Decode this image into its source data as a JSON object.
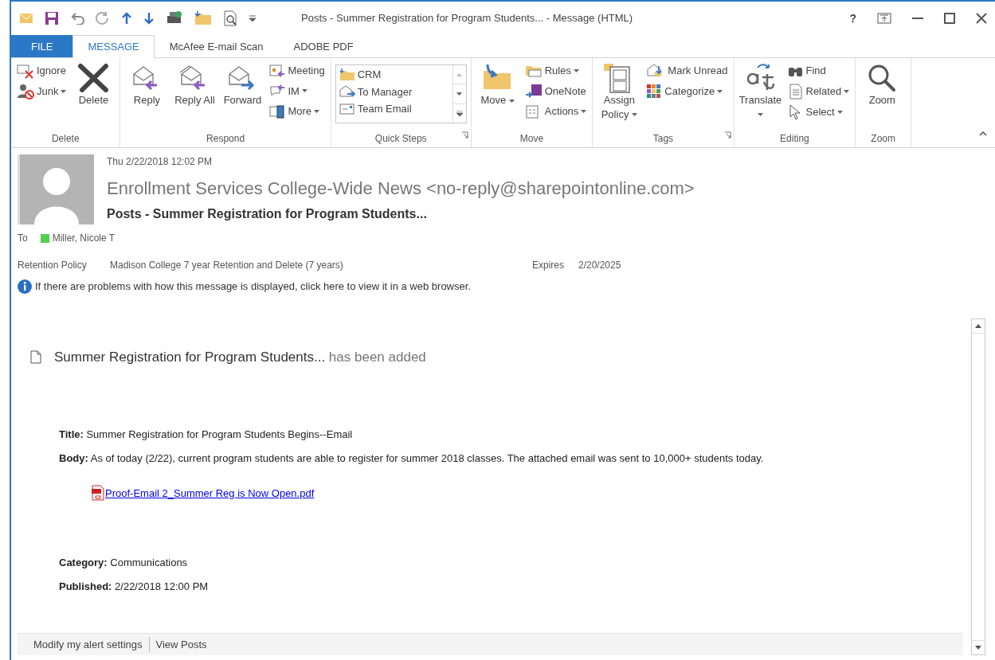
{
  "window": {
    "title": "Posts - Summer Registration for Program Students... - Message (HTML)",
    "help": "?"
  },
  "tabs": [
    {
      "label": "FILE",
      "kind": "file",
      "selected": false
    },
    {
      "label": "MESSAGE",
      "kind": "tab",
      "selected": true
    },
    {
      "label": "McAfee E-mail Scan",
      "kind": "tab",
      "selected": false
    },
    {
      "label": "ADOBE PDF",
      "kind": "tab",
      "selected": false
    }
  ],
  "ribbon": [
    {
      "name": "Delete",
      "launcher": false,
      "items": [
        {
          "kind": "small",
          "label": "Ignore",
          "dropdown": false
        },
        {
          "kind": "small",
          "label": "Junk",
          "dropdown": true
        },
        {
          "kind": "large",
          "label": "Delete",
          "dropdown": false
        }
      ]
    },
    {
      "name": "Respond",
      "launcher": false,
      "items": [
        {
          "kind": "large",
          "label": "Reply",
          "dropdown": false
        },
        {
          "kind": "large",
          "label": "Reply All",
          "dropdown": false
        },
        {
          "kind": "large",
          "label": "Forward",
          "dropdown": false
        },
        {
          "kind": "small",
          "label": "Meeting",
          "dropdown": false
        },
        {
          "kind": "small",
          "label": "IM",
          "dropdown": true
        },
        {
          "kind": "small",
          "label": "More",
          "dropdown": true
        }
      ]
    },
    {
      "name": "Quick Steps",
      "launcher": true,
      "items": [
        {
          "kind": "gallery",
          "entries": [
            "CRM",
            "To Manager",
            "Team Email"
          ]
        }
      ]
    },
    {
      "name": "Move",
      "launcher": false,
      "items": [
        {
          "kind": "large",
          "label": "Move",
          "dropdown": true
        },
        {
          "kind": "small",
          "label": "Rules",
          "dropdown": true
        },
        {
          "kind": "small",
          "label": "OneNote",
          "dropdown": false
        },
        {
          "kind": "small",
          "label": "Actions",
          "dropdown": true
        }
      ]
    },
    {
      "name": "Tags",
      "launcher": true,
      "items": [
        {
          "kind": "large",
          "label": "Assign Policy",
          "dropdown": true
        },
        {
          "kind": "small",
          "label": "Mark Unread",
          "dropdown": false
        },
        {
          "kind": "small",
          "label": "Categorize",
          "dropdown": true
        }
      ]
    },
    {
      "name": "Editing",
      "launcher": false,
      "items": [
        {
          "kind": "large",
          "label": "Translate",
          "dropdown": true
        },
        {
          "kind": "small",
          "label": "Find",
          "dropdown": false
        },
        {
          "kind": "small",
          "label": "Related",
          "dropdown": true
        },
        {
          "kind": "small",
          "label": "Select",
          "dropdown": true
        }
      ]
    },
    {
      "name": "Zoom",
      "launcher": false,
      "items": [
        {
          "kind": "large",
          "label": "Zoom",
          "dropdown": false
        }
      ]
    }
  ],
  "header": {
    "date": "Thu 2/22/2018 12:02 PM",
    "sender": "Enrollment Services College-Wide News <no-reply@sharepointonline.com>",
    "subject": "Posts - Summer Registration for Program Students...",
    "to_label": "To",
    "recipients": [
      {
        "name": "Miller, Nicole T",
        "color": "#4fd04f"
      }
    ],
    "retention_label": "Retention Policy",
    "retention_value": "Madison College 7 year Retention and Delete (7 years)",
    "expires_label": "Expires",
    "expires_value": "2/20/2025",
    "info": "If there are problems with how this message is displayed, click here to view it in a web browser."
  },
  "body": {
    "item_title": "Summer Registration for Program Students...",
    "item_suffix": "has been added",
    "fields": [
      {
        "text": "**Title:** Summer Registration for Program Students Begins--Email"
      },
      {
        "text": "**Body:** As of today (2/22), current program students are able to register for summer 2018 classes. The attached email was sent to 10,000+ students today."
      }
    ],
    "attachment": "Proof-Email 2_Summer Reg is Now Open.pdf",
    "meta": [
      {
        "text": "**Category:** Communications"
      },
      {
        "text": "**Published:** 2/22/2018 12:00 PM"
      }
    ],
    "footer_links": [
      "Modify my alert settings",
      "View Posts"
    ]
  }
}
